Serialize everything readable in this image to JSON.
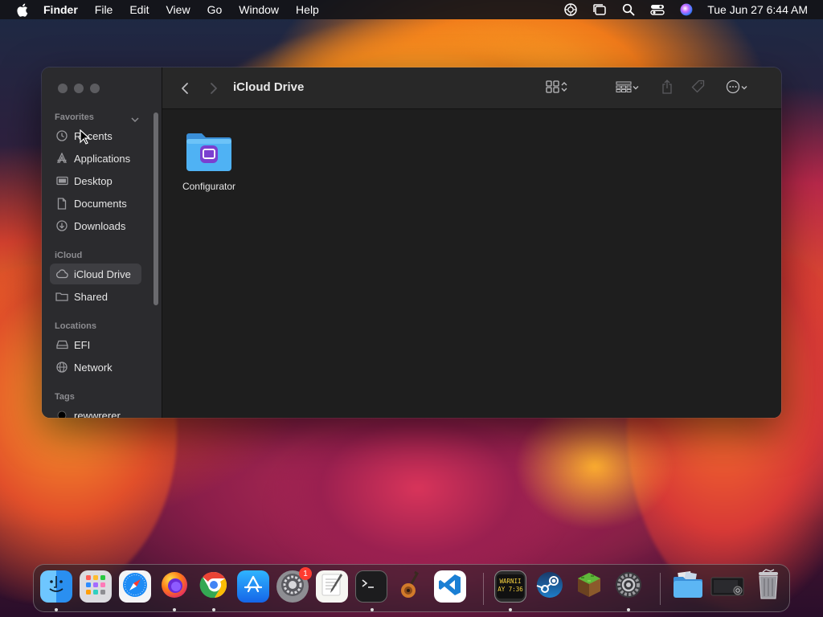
{
  "menubar": {
    "items": [
      "Finder",
      "File",
      "Edit",
      "View",
      "Go",
      "Window",
      "Help"
    ],
    "clock": "Tue Jun 27  6:44 AM",
    "status_icons": [
      "screen-time-icon",
      "stage-manager-icon",
      "spotlight-icon",
      "control-center-icon",
      "siri-icon"
    ]
  },
  "window": {
    "title": "iCloud Drive",
    "sidebar": {
      "favorites_label": "Favorites",
      "favorites": [
        {
          "label": "Recents",
          "icon": "clock-icon"
        },
        {
          "label": "Applications",
          "icon": "applications-icon"
        },
        {
          "label": "Desktop",
          "icon": "desktop-icon"
        },
        {
          "label": "Documents",
          "icon": "document-icon"
        },
        {
          "label": "Downloads",
          "icon": "download-icon"
        }
      ],
      "icloud_label": "iCloud",
      "icloud": [
        {
          "label": "iCloud Drive",
          "icon": "cloud-icon"
        },
        {
          "label": "Shared",
          "icon": "shared-folder-icon"
        }
      ],
      "locations_label": "Locations",
      "locations": [
        {
          "label": "EFI",
          "icon": "drive-icon"
        },
        {
          "label": "Network",
          "icon": "network-icon"
        }
      ],
      "tags_label": "Tags",
      "tags": [
        {
          "label": "rewwrerer",
          "color": "#000000"
        }
      ]
    },
    "content": {
      "items": [
        {
          "label": "Configurator",
          "icon": "folder-configurator-icon"
        }
      ]
    }
  },
  "dock": {
    "apps": [
      {
        "name": "Finder",
        "icon": "finder-icon",
        "running": true
      },
      {
        "name": "Launchpad",
        "icon": "launchpad-icon",
        "running": false
      },
      {
        "name": "Safari",
        "icon": "safari-icon",
        "running": false
      },
      {
        "name": "Firefox",
        "icon": "firefox-icon",
        "running": true
      },
      {
        "name": "Chrome",
        "icon": "chrome-icon",
        "running": true
      },
      {
        "name": "App Store",
        "icon": "app-store-icon",
        "running": false
      },
      {
        "name": "System Preferences",
        "icon": "system-preferences-icon",
        "running": false,
        "badge": "1"
      },
      {
        "name": "TextEdit",
        "icon": "textedit-icon",
        "running": false
      },
      {
        "name": "Terminal",
        "icon": "terminal-icon",
        "running": true
      },
      {
        "name": "GarageBand",
        "icon": "garageband-icon",
        "running": false
      },
      {
        "name": "Visual Studio Code",
        "icon": "vscode-icon",
        "running": false
      },
      {
        "name": "Console",
        "icon": "console-icon",
        "running": true,
        "text": "WARNII\nAY 7:36"
      },
      {
        "name": "Steam",
        "icon": "steam-icon",
        "running": false
      },
      {
        "name": "Minecraft",
        "icon": "minecraft-icon",
        "running": false
      },
      {
        "name": "System Settings",
        "icon": "system-settings-icon",
        "running": true
      },
      {
        "name": "Downloads Folder",
        "icon": "downloads-stack-icon",
        "running": false
      },
      {
        "name": "Screenshot",
        "icon": "screenshot-icon",
        "running": false
      },
      {
        "name": "Trash",
        "icon": "trash-icon",
        "running": false
      }
    ]
  },
  "colors": {
    "accent_folder": "#4aa8f0",
    "window_bg": "#1e1e1e",
    "sidebar_bg": "#2b2b2e"
  }
}
